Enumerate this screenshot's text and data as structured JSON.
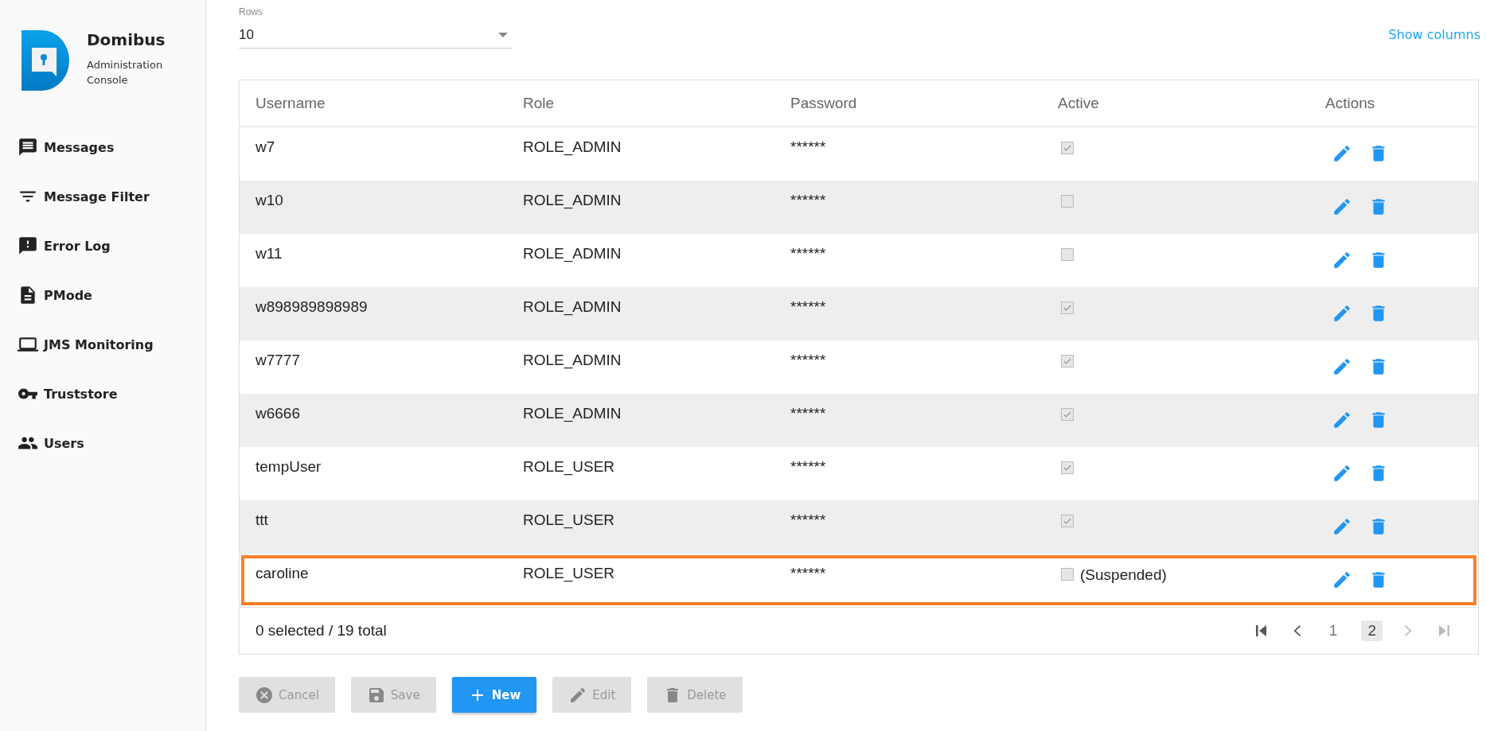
{
  "brand": {
    "name": "Domibus",
    "subtitle": "Administration Console"
  },
  "sidebar": {
    "items": [
      {
        "label": "Messages"
      },
      {
        "label": "Message Filter"
      },
      {
        "label": "Error Log"
      },
      {
        "label": "PMode"
      },
      {
        "label": "JMS Monitoring"
      },
      {
        "label": "Truststore"
      },
      {
        "label": "Users"
      }
    ]
  },
  "rows_select": {
    "label": "Rows",
    "value": "10"
  },
  "show_columns": "Show columns",
  "table": {
    "columns": [
      "Username",
      "Role",
      "Password",
      "Active",
      "Actions"
    ],
    "rows": [
      {
        "username": "w7",
        "role": "ROLE_ADMIN",
        "password": "******",
        "active": true,
        "highlighted": false
      },
      {
        "username": "w10",
        "role": "ROLE_ADMIN",
        "password": "******",
        "active": false,
        "highlighted": false
      },
      {
        "username": "w11",
        "role": "ROLE_ADMIN",
        "password": "******",
        "active": false,
        "highlighted": false
      },
      {
        "username": "w898989898989",
        "role": "ROLE_ADMIN",
        "password": "******",
        "active": true,
        "highlighted": false
      },
      {
        "username": "w7777",
        "role": "ROLE_ADMIN",
        "password": "******",
        "active": true,
        "highlighted": false
      },
      {
        "username": "w6666",
        "role": "ROLE_ADMIN",
        "password": "******",
        "active": true,
        "highlighted": false
      },
      {
        "username": "tempUser",
        "role": "ROLE_USER",
        "password": "******",
        "active": true,
        "highlighted": false
      },
      {
        "username": "ttt",
        "role": "ROLE_USER",
        "password": "******",
        "active": true,
        "highlighted": false
      },
      {
        "username": "caroline",
        "role": "ROLE_USER",
        "password": "******",
        "active": false,
        "status": "(Suspended)",
        "highlighted": true
      }
    ]
  },
  "footer": {
    "summary": "0 selected / 19 total",
    "pager": [
      {
        "kind": "first",
        "disabled": false
      },
      {
        "kind": "prev",
        "disabled": false
      },
      {
        "kind": "page",
        "label": "1",
        "selected": false
      },
      {
        "kind": "page",
        "label": "2",
        "selected": true
      },
      {
        "kind": "next",
        "disabled": true
      },
      {
        "kind": "last",
        "disabled": true
      }
    ]
  },
  "buttons": [
    {
      "label": "Cancel",
      "primary": false,
      "disabled": true
    },
    {
      "label": "Save",
      "primary": false,
      "disabled": true
    },
    {
      "label": "New",
      "primary": true,
      "disabled": false
    },
    {
      "label": "Edit",
      "primary": false,
      "disabled": true
    },
    {
      "label": "Delete",
      "primary": false,
      "disabled": true
    }
  ]
}
